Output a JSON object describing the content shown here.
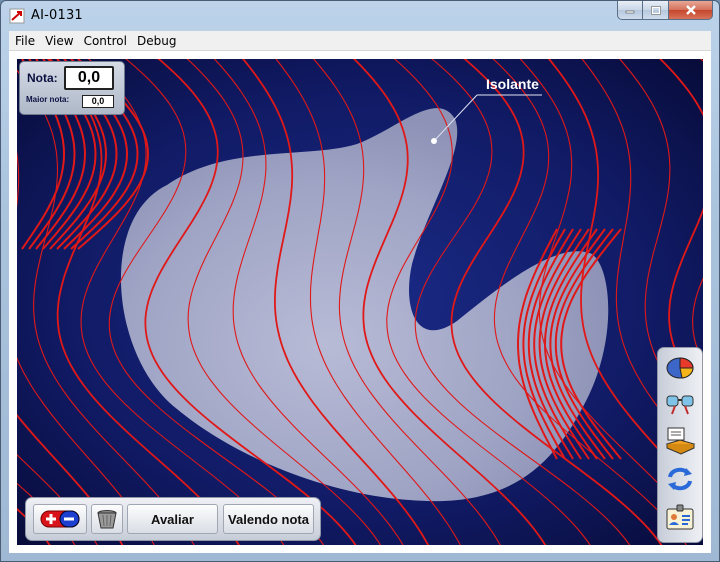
{
  "window": {
    "title": "AI-0131"
  },
  "menu": [
    "File",
    "View",
    "Control",
    "Debug"
  ],
  "score": {
    "nota_label": "Nota:",
    "nota_value": "0,0",
    "maior_label": "Maior nota:",
    "maior_value": "0,0"
  },
  "scene": {
    "isolante_label": "Isolante"
  },
  "toolbar": {
    "avaliar_label": "Avaliar",
    "valendo_label": "Valendo nota"
  },
  "colors": {
    "field_lines": "#e01818",
    "background": "#0c1450",
    "insulator": "#a8acc8"
  },
  "icons": {
    "tool": [
      "charges-icon",
      "trash-bucket-icon"
    ],
    "side": [
      "pie-chart-icon",
      "glasses-icon",
      "info-book-icon",
      "reset-arrows-icon",
      "id-card-icon"
    ]
  }
}
